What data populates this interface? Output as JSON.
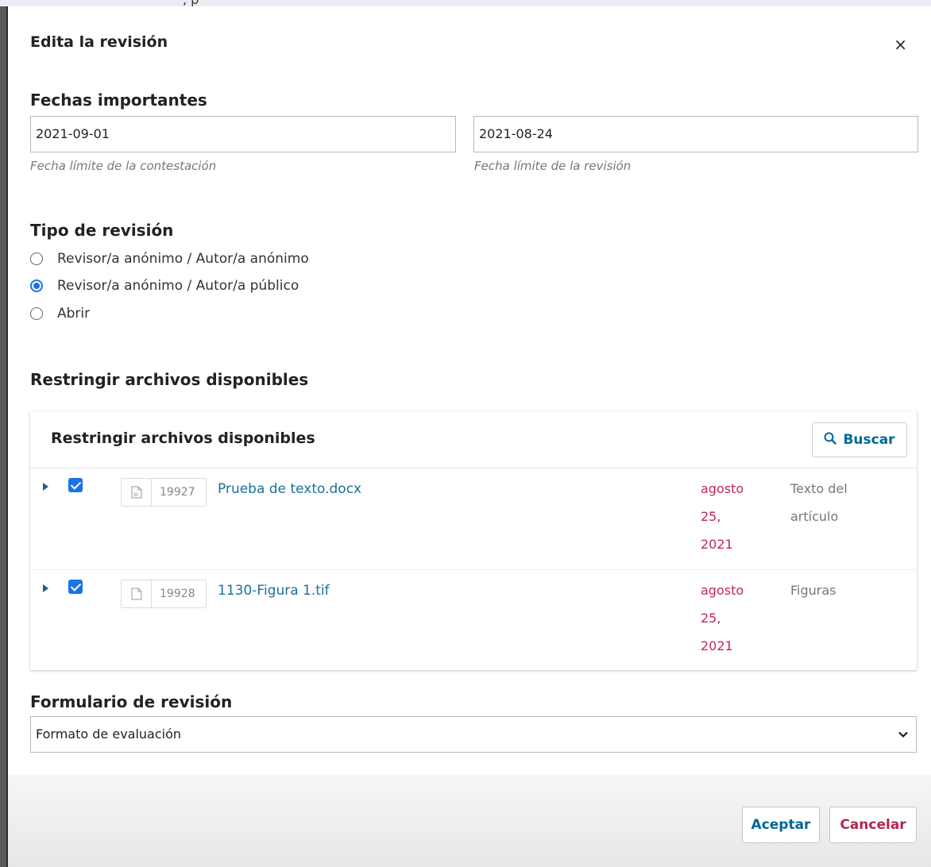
{
  "backdrop": {
    "fragment": ", p"
  },
  "modal": {
    "title": "Edita la revisión",
    "close_label": "×"
  },
  "dates": {
    "heading": "Fechas importantes",
    "response_due": {
      "value": "2021-09-01",
      "helper": "Fecha límite de la contestación"
    },
    "review_due": {
      "value": "2021-08-24",
      "helper": "Fecha límite de la revisión"
    }
  },
  "review_type": {
    "heading": "Tipo de revisión",
    "options": [
      {
        "label": "Revisor/a anónimo / Autor/a anónimo",
        "checked": false
      },
      {
        "label": "Revisor/a anónimo / Autor/a público",
        "checked": true
      },
      {
        "label": "Abrir",
        "checked": false
      }
    ]
  },
  "restrict_files": {
    "heading": "Restringir archivos disponibles",
    "panel_title": "Restringir archivos disponibles",
    "search_label": "Buscar",
    "files": [
      {
        "id": "19927",
        "icon": "word-doc-icon",
        "name": "Prueba de texto.docx",
        "date": "agosto\n25,\n2021",
        "type": "Texto del\nartículo",
        "checked": true
      },
      {
        "id": "19928",
        "icon": "file-icon",
        "name": "1130-Figura 1.tif",
        "date": "agosto\n25,\n2021",
        "type": "Figuras",
        "checked": true
      }
    ]
  },
  "review_form": {
    "heading": "Formulario de revisión",
    "selected": "Formato de evaluación"
  },
  "footer": {
    "accept_label": "Aceptar",
    "cancel_label": "Cancelar"
  },
  "colors": {
    "link": "#1b6f9b",
    "accent": "#006798",
    "date": "#c0265e",
    "cancel": "#b5264d",
    "checkbox": "#1a73e8"
  }
}
